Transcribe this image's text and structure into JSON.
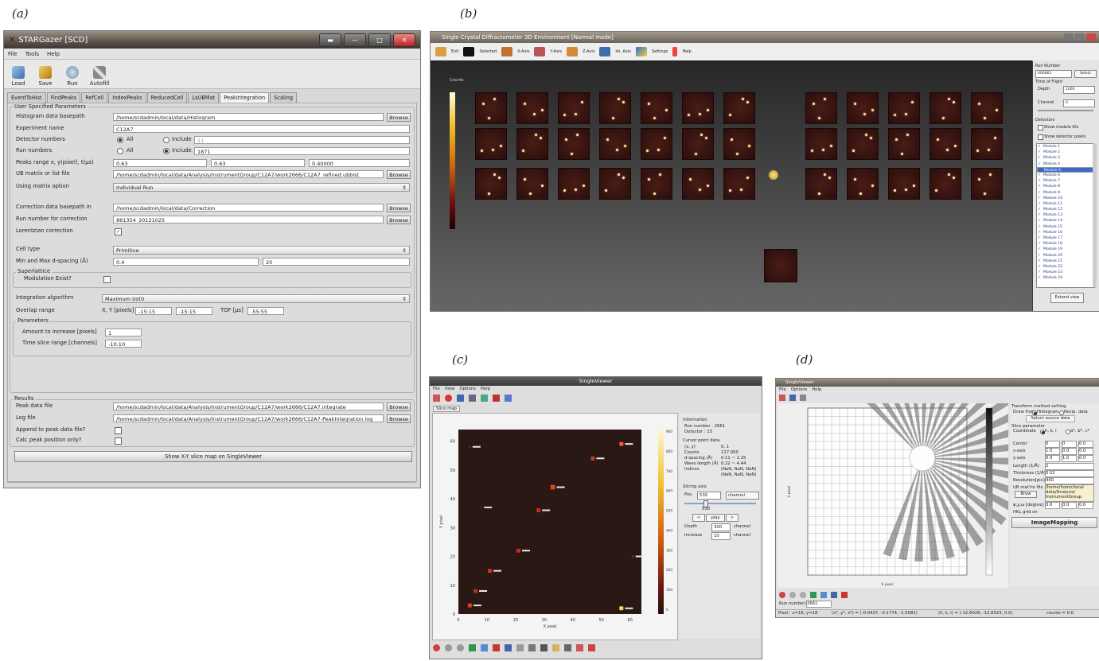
{
  "figure_labels": {
    "a": "(a)",
    "b": "(b)",
    "c": "(c)",
    "d": "(d)"
  },
  "panel_a": {
    "title": "STARGazer [SCD]",
    "menu": [
      "File",
      "Tools",
      "Help"
    ],
    "toolbar": [
      "Load",
      "Save",
      "Run",
      "Autofill"
    ],
    "tabs": [
      "EventToHist",
      "FindPeaks",
      "RefCell",
      "IndexPeaks",
      "ReducedCell",
      "LsUBMat",
      "PeakIntegration",
      "Scaling"
    ],
    "active_tab": "PeakIntegration",
    "group_user": "User Specified Parameters",
    "labels": {
      "histogram": "Histogram data basepath",
      "experiment": "Experiment name",
      "detectors": "Detector numbers",
      "runs": "Run numbers",
      "peaks_range": "Peaks range x, y(pixel), t(μs)",
      "ub_matrix": "UB matrix or list file",
      "using_matrix": "Using matrix option",
      "correction_path": "Correction data basepath in",
      "correction_run": "Run number for correction",
      "lorentzian": "Lorentzian correction",
      "cell_type": "Cell type",
      "dspacing": "Min and Max d-spacing (Å)",
      "superlattice": "Superlattice",
      "modulation": "Modulation Exist?",
      "integration": "Integration algorithm",
      "overlap": "Overlap range",
      "xy_pixels": "X, Y [pixels]",
      "tof": "TOF [μs]",
      "parameters": "Parameters",
      "amount": "Amount to increase [pixels]",
      "timeslice": "Time slice range [channels]",
      "results": "Results",
      "peak_data": "Peak data file",
      "log_file": "Log file",
      "append": "Append to peak data file?",
      "calc_only": "Calc peak position only?"
    },
    "values": {
      "histogram": "/home/scdadmin/local/data/Histogram",
      "experiment": "C12A7",
      "all": "All",
      "include": "Include",
      "det_include": "11",
      "run_include": "1871",
      "peaks_x": "0.63",
      "peaks_y": "0.63",
      "peaks_t": "0.40000",
      "ub_matrix": "/home/scdadmin/local/data/Analysis/InstrumentGroup/C12A7/work2666/C12A7_refined.ubbist",
      "using_matrix": "Individual Run",
      "correction_path": "/home/scdadmin/local/data/Correction",
      "correction_run": "861354_20121025",
      "cell_type": "Primitive",
      "dmin": "0.4",
      "dmax": "20",
      "integration": "Maximum I/σ(I)",
      "overlap_x": "-15:15",
      "overlap_y": "-15:15",
      "overlap_tof": "-55:55",
      "amount": "1",
      "timeslice": "-10:10",
      "peak_data": "/home/scdadmin/local/data/Analysis/InstrumentGroup/C12A7/work2666/C12A7.integrate",
      "log_file": "/home/scdadmin/local/data/Analysis/InstrumentGroup/C12A7/work2666/C12A7-PeakIntegration.log"
    },
    "browse": "Browse",
    "show_button": "Show X-Y slice map on SingleViewer"
  },
  "panel_b": {
    "title": "Single Crystal Diffractometer 3D Environment [Normal mode]",
    "toolbar": [
      "Exit",
      "Selected",
      "X-Axis",
      "Y-Axis",
      "Z-Axis",
      "Ini. Axis",
      "Settings",
      "Help"
    ],
    "colorbar_label": "Counts",
    "side": {
      "run_number_label": "Run Number",
      "run_number": "000865",
      "select": "Select",
      "tof_label": "Time of Flight",
      "depth_label": "Depth",
      "depth": "1000",
      "channel_label": "Channel",
      "channel": "0",
      "detectors_label": "Detectors",
      "show_module": "Show module IDs",
      "show_pixels": "Show detector pixels",
      "modules": [
        "Module 1",
        "Module 2",
        "Module 3",
        "Module 4",
        "Module 5",
        "Module 6",
        "Module 7",
        "Module 8",
        "Module 9",
        "Module 10",
        "Module 11",
        "Module 12",
        "Module 13",
        "Module 14",
        "Module 15",
        "Module 16",
        "Module 17",
        "Module 18",
        "Module 19",
        "Module 20",
        "Module 21",
        "Module 22",
        "Module 23",
        "Module 24"
      ],
      "selected_index": 4,
      "extend": "Extend view"
    }
  },
  "panel_c": {
    "title": "SingleViewer",
    "menu": [
      "File",
      "View",
      "Options",
      "Help"
    ],
    "tab": "Slice map",
    "xlabel": "X pixel",
    "ylabel": "Y pixel",
    "xticks": [
      "0",
      "10",
      "20",
      "30",
      "40",
      "50",
      "60"
    ],
    "yticks": [
      "0",
      "10",
      "20",
      "30",
      "40",
      "50",
      "60"
    ],
    "cbticks": [
      "900",
      "800",
      "700",
      "600",
      "500",
      "400",
      "300",
      "200",
      "100",
      "0"
    ],
    "info": {
      "header": "Information",
      "run": "Run number : 2661",
      "detector": "Detector :   15",
      "cursor_header": "Cursor point data",
      "rows": [
        [
          "(x, y)",
          "0,  1"
        ],
        [
          "Counts",
          "117.000"
        ],
        [
          "d-spacing (Å)",
          "0.11 ~ 2.25"
        ],
        [
          "Wave length (Å)",
          "0.22 ~ 4.44"
        ],
        [
          "Indices",
          "(NaN, NaN, NaN)"
        ],
        [
          "",
          "(NaN, NaN, NaN)"
        ]
      ],
      "slicing": "Slicing axis",
      "pos_label": "Pos.",
      "pos": "530",
      "channel": "channel",
      "slider_val": "530",
      "play": "play",
      "prev": "<",
      "next": ">",
      "depth_label": "Depth",
      "depth": "300",
      "increase_label": "Increase",
      "increase": "10"
    }
  },
  "panel_d": {
    "title": "SingleViewer",
    "menu": [
      "File",
      "Options",
      "Help"
    ],
    "xlabel": "X pixel",
    "ylabel": "Y pixel",
    "side": {
      "transform": "Transform method setting",
      "draw_from": "Draw from",
      "histogram": "Histogram",
      "recip": "Recip. data",
      "select_source": "Select source data",
      "slice_param": "Slice parameter",
      "coordinate": "Coordinate",
      "hkl": "h, k, l",
      "astar": "a*, b*, c*",
      "center": "Center",
      "xaxis": "x-axis",
      "yaxis": "y-axis",
      "center_vals": [
        "0",
        "0",
        "0.0"
      ],
      "x_vals": [
        "1.0",
        "0.0",
        "0.0"
      ],
      "y_vals": [
        "0.0",
        "1.0",
        "0.0"
      ],
      "length_label": "Length (1/Å)",
      "length": "2",
      "thickness_label": "Thickness (1/Å)",
      "thickness": "0.02",
      "resolution_label": "Resolution[pix]",
      "resolution": "400",
      "ub_label": "UB mat'rix file",
      "browse": "Brow",
      "ub_value": "/home/home/local data/Analysis/ InstrumentGroup",
      "angles_label": "φ,χ,ω [degree]",
      "angles": [
        "0.0",
        "0.0",
        "0.0"
      ],
      "hkl_grid": "HKL grid on",
      "image_mapping": "ImageMapping"
    },
    "status": {
      "run_label": "Run number:",
      "run": "2661",
      "pixel": "Pixel : x=16, y=18",
      "qcoords": "(x*, y*, z*) = (-0.0427, -0.1774, -1.5081)",
      "hkl": "(h, k, l) = (-12.6026, -12.6023, 0.0)",
      "counts": "counts = 0.0"
    }
  }
}
